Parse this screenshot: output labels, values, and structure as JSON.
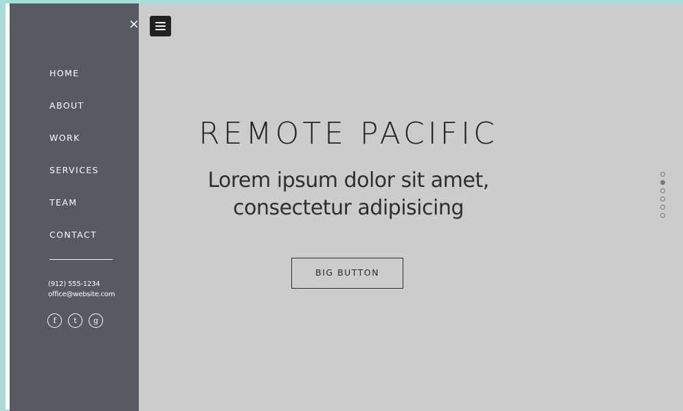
{
  "sidebar": {
    "close_symbol": "×",
    "nav": [
      "HOME",
      "ABOUT",
      "WORK",
      "SERVICES",
      "TEAM",
      "CONTACT"
    ],
    "phone": "(912) 555-1234",
    "email": "office@website.com",
    "socials": [
      {
        "icon": "facebook-icon",
        "glyph": "f"
      },
      {
        "icon": "twitter-icon",
        "glyph": "t"
      },
      {
        "icon": "google-plus-icon",
        "glyph": "g"
      }
    ]
  },
  "hero": {
    "title": "REMOTE PACIFIC",
    "subtitle_line1": "Lorem ipsum dolor sit amet,",
    "subtitle_line2": "consectetur adipisicing",
    "button_label": "BIG BUTTON"
  },
  "pagination": {
    "total": 6,
    "active_index": 1
  },
  "colors": {
    "sidebar_bg": "#575a63",
    "main_bg": "#cccccc",
    "outer_bg": "#a6dcd4",
    "text_dark": "#222222"
  }
}
